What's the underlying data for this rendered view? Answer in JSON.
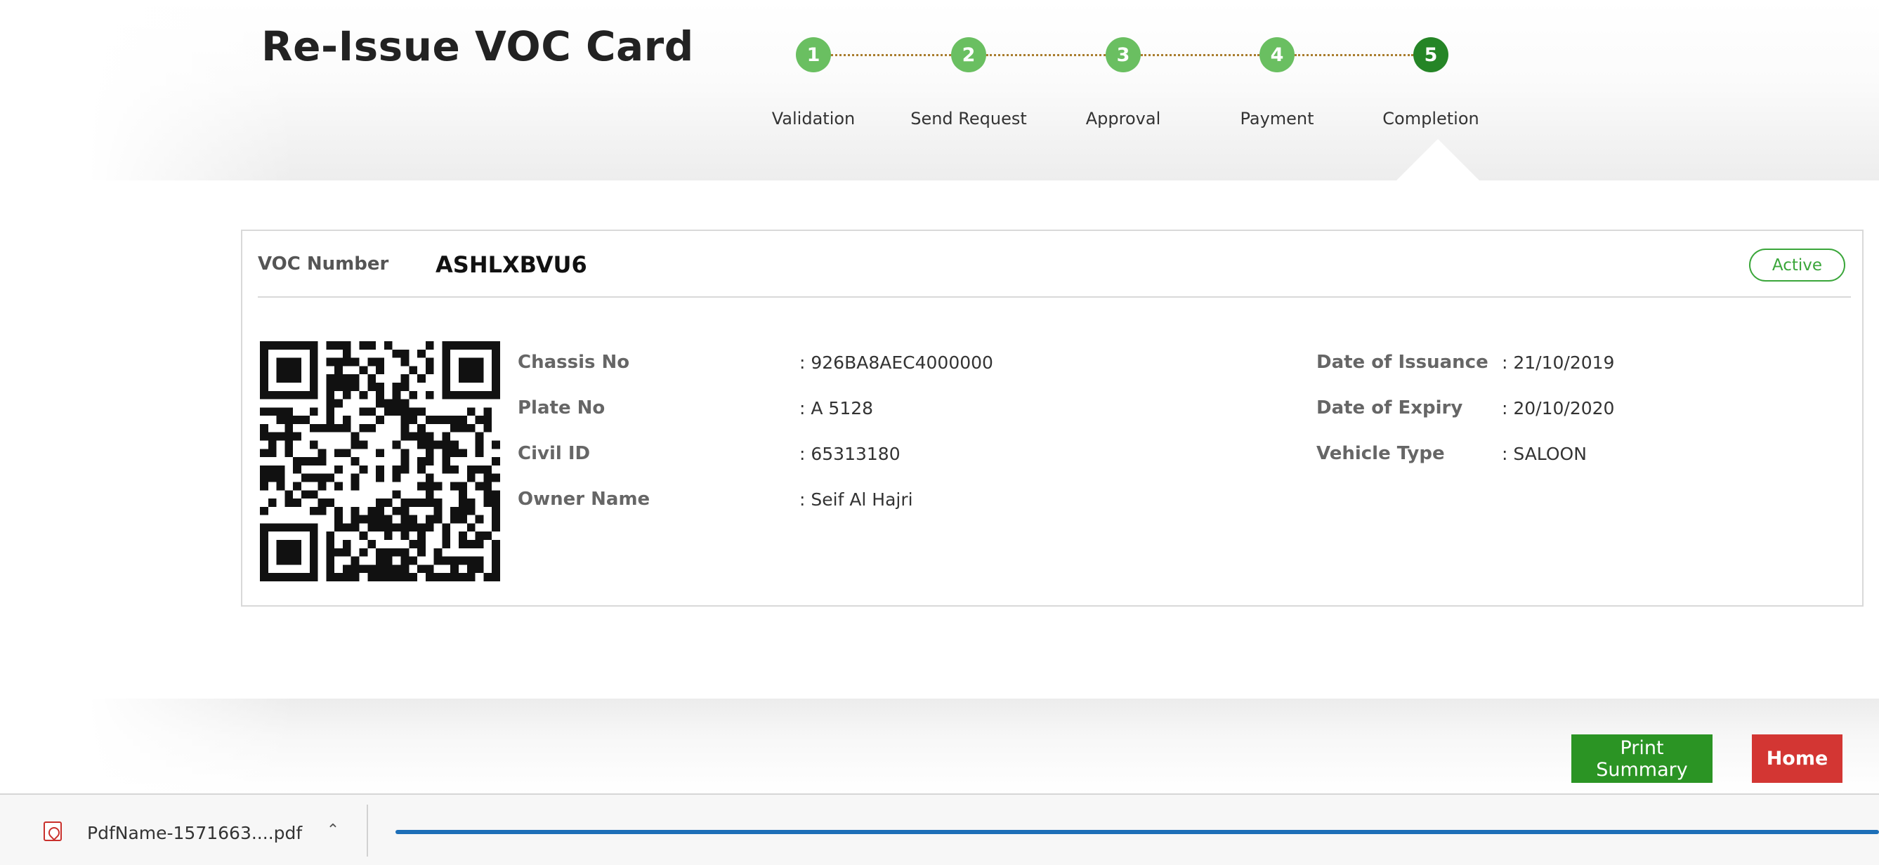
{
  "page": {
    "title": "Re-Issue VOC Card"
  },
  "stepper": {
    "steps": [
      {
        "number": "1",
        "label": "Validation",
        "state": "done"
      },
      {
        "number": "2",
        "label": "Send Request",
        "state": "done"
      },
      {
        "number": "3",
        "label": "Approval",
        "state": "done"
      },
      {
        "number": "4",
        "label": "Payment",
        "state": "done"
      },
      {
        "number": "5",
        "label": "Completion",
        "state": "current"
      }
    ],
    "colors": {
      "done": "#6abf61",
      "current": "#258526",
      "connector": "#a97d2e"
    }
  },
  "card": {
    "voc_label": "VOC Number",
    "voc_value": "ASHLXBVU6",
    "status": "Active",
    "status_color": "#3aa63a",
    "left_fields": [
      {
        "label": "Chassis No",
        "value": ": 926BA8AEC4000000"
      },
      {
        "label": "Plate No",
        "value": ": A 5128"
      },
      {
        "label": "Civil ID",
        "value": ": 65313180"
      },
      {
        "label": "Owner Name",
        "value": ": Seif Al Hajri"
      }
    ],
    "right_fields": [
      {
        "label": "Date of Issuance",
        "value": ": 21/10/2019"
      },
      {
        "label": "Date of Expiry",
        "value": ": 20/10/2020"
      },
      {
        "label": "Vehicle Type",
        "value": ": SALOON"
      }
    ],
    "qr_icon": "qr-code"
  },
  "actions": {
    "print_label": "Print Summary",
    "home_label": "Home",
    "print_color": "#2b9424",
    "home_color": "#d33633"
  },
  "download_bar": {
    "filename": "PdfName-1571663....pdf",
    "chevron_icon": "chevron-up-icon",
    "file_icon": "pdf-icon",
    "progress_color": "#1d6fb8",
    "progress": 1.0
  }
}
